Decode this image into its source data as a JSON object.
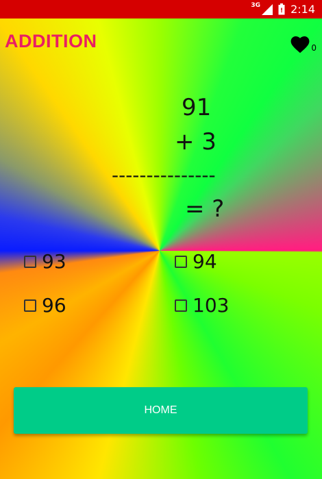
{
  "status_bar": {
    "network": "3G",
    "time": "2:14",
    "color": "#d50000",
    "icons": [
      "signal-icon",
      "battery-icon"
    ]
  },
  "header": {
    "title": "ADDITION",
    "title_color": "#e91e63",
    "lives_icon": "heart-icon",
    "lives_count": "0"
  },
  "problem": {
    "first_number": "91",
    "second_line": "+ 3",
    "divider": "---------------",
    "result_line": "= ?"
  },
  "options": [
    {
      "label": "93",
      "checked": false
    },
    {
      "label": "94",
      "checked": false
    },
    {
      "label": "96",
      "checked": false
    },
    {
      "label": "103",
      "checked": false
    }
  ],
  "home_button": {
    "label": "HOME",
    "color": "#00cc88"
  }
}
